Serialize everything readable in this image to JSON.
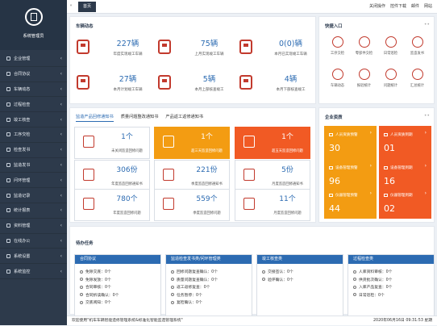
{
  "sidebar": {
    "role": "系统管理员",
    "items": [
      {
        "label": "企业管理"
      },
      {
        "label": "合同协议"
      },
      {
        "label": "车辆动态"
      },
      {
        "label": "过程检查"
      },
      {
        "label": "竣工核查"
      },
      {
        "label": "工序交检"
      },
      {
        "label": "检查发书"
      },
      {
        "label": "监造发书"
      },
      {
        "label": "问环管理"
      },
      {
        "label": "监造记录"
      },
      {
        "label": "统计报表"
      },
      {
        "label": "资料管理"
      },
      {
        "label": "在线办公"
      },
      {
        "label": "系统设置"
      },
      {
        "label": "系统监控"
      }
    ]
  },
  "topbar": {
    "tab": "首页",
    "actions": [
      {
        "label": "关闭操作"
      },
      {
        "label": "控件下载"
      },
      {
        "label": "邮件"
      },
      {
        "label": "网站"
      }
    ]
  },
  "vehicle": {
    "title": "车辆动态",
    "stats": [
      {
        "value": "227辆",
        "label": "年度实现竣工车辆"
      },
      {
        "value": "75辆",
        "label": "上月实现竣工车辆"
      },
      {
        "value": "0(0)辆",
        "label": "本月已实现竣工车辆"
      },
      {
        "value": "27辆",
        "label": "本月计划竣工车辆"
      },
      {
        "value": "5辆",
        "label": "本月上部核查竣工"
      },
      {
        "value": "4辆",
        "label": "本月下部核查竣工"
      }
    ]
  },
  "quick": {
    "title": "快捷入口",
    "items": [
      {
        "label": "工序交检"
      },
      {
        "label": "零部件交检"
      },
      {
        "label": "日常巡检"
      },
      {
        "label": "监造发书"
      },
      {
        "label": "车辆动态"
      },
      {
        "label": "报验统计"
      },
      {
        "label": "问题统计"
      },
      {
        "label": "汇总统计"
      }
    ]
  },
  "notices": {
    "tabs": [
      {
        "label": "监造产品回修通知书"
      },
      {
        "label": "质量问题整改通知书"
      },
      {
        "label": "产品返工返修通知书"
      }
    ],
    "boxes": [
      {
        "value": "1个",
        "label": "未关闭监造回修问题"
      },
      {
        "value": "1个",
        "label": "超三天监造回修问题"
      },
      {
        "value": "1个",
        "label": "超五天监造回修问题"
      },
      {
        "value": "306份",
        "label": "年度监造回修通知书"
      },
      {
        "value": "221份",
        "label": "季度监造回修通知书"
      },
      {
        "value": "5份",
        "label": "月度监造回修通知书"
      },
      {
        "value": "780个",
        "label": "年度监造回修问题"
      },
      {
        "value": "559个",
        "label": "季度监造回修问题"
      },
      {
        "value": "11个",
        "label": "月度监造回修问题"
      }
    ]
  },
  "enterprise": {
    "title": "企业资质",
    "cards": [
      {
        "label": "人员资质预警",
        "value": "30",
        "color": "#f39c12"
      },
      {
        "label": "人员资质到期",
        "value": "01",
        "color": "#f15a24"
      },
      {
        "label": "设备管理预警",
        "value": "96",
        "color": "#f39c12"
      },
      {
        "label": "设备管理到期",
        "value": "16",
        "color": "#f15a24"
      },
      {
        "label": "仪器管理预警",
        "value": "44",
        "color": "#f39c12"
      },
      {
        "label": "仪器管理到期",
        "value": "02",
        "color": "#f15a24"
      }
    ]
  },
  "todo": {
    "title": "待办任务",
    "columns": [
      {
        "header": "合同协议",
        "items": [
          "免除交底：0个",
          "免除发放：0个",
          "合同审核：0个",
          "合同拆读确认：0个",
          "交底阅知：0个"
        ]
      },
      {
        "header": "监造检查发书类/问环管理类",
        "items": [
          "回修问题复查确认：0个",
          "质量问题复查确认：0个",
          "返工返修复查：0个",
          "任务暂停：0个",
          "复检确认：0个"
        ]
      },
      {
        "header": "竣工核查类",
        "items": [
          "交接签认：0个",
          "验评确认：0个"
        ]
      },
      {
        "header": "过程检查类",
        "items": [
          "人库资料审核：0个",
          "供货批次确认：0个",
          "入库产品复查：0个",
          "日常巡检：0个"
        ]
      }
    ]
  },
  "footer": {
    "welcome": "欢迎使用\"机车车辆智能造修管理系统&标准化智能监造管理系统\"",
    "datetime": "2020年06月16日 09:31:53 星期"
  },
  "colors": {
    "sidebar": "#2d3a4b",
    "accent": "#2c6bb2",
    "warning": "#f39c12",
    "danger": "#f15a24",
    "icon": "#c23a2d"
  }
}
